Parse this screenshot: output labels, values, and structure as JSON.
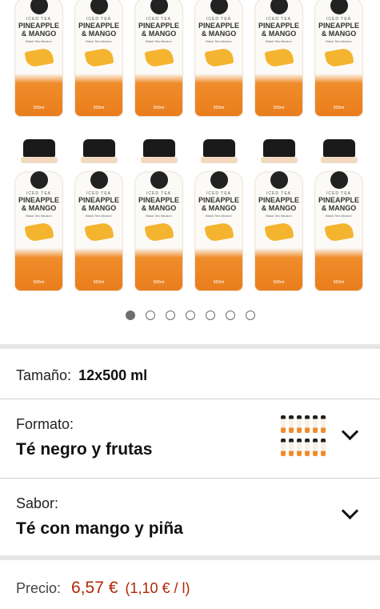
{
  "product_gallery": {
    "bottle_label": {
      "badge": "ICED TEA",
      "name_line1": "PINEAPPLE",
      "name_line2": "& MANGO",
      "subtitle": "Black Tea Infusion",
      "volume": "500ml"
    },
    "dots_total": 7,
    "active_dot_index": 0
  },
  "size": {
    "label": "Tamaño:",
    "value": "12x500 ml"
  },
  "format": {
    "label": "Formato:",
    "value": "Té negro y frutas"
  },
  "flavor": {
    "label": "Sabor:",
    "value": "Té con mango y piña"
  },
  "price": {
    "label": "Precio:",
    "value": "6,57 €",
    "unit_price": "(1,10 € / l)"
  },
  "icons": {
    "chevron": "chevron-down-icon"
  }
}
